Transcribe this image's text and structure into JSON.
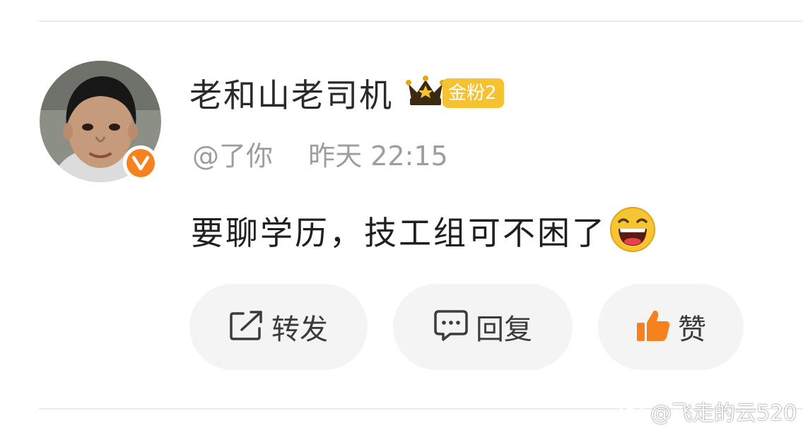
{
  "comment_card": {
    "username": "老和山老司机",
    "fan_badge": {
      "label": "金粉2",
      "icon": "crown-icon",
      "color": "#f5c332"
    },
    "verified_badge": {
      "icon": "verified-v-icon",
      "color": "#f5821f"
    },
    "reply_to": "@了你",
    "timestamp": "昨天 22:15",
    "comment_text": "要聊学历，技工组可不困了",
    "emoji": "laughing-face-emoji"
  },
  "actions": {
    "forward": {
      "label": "转发",
      "icon": "share-out-icon"
    },
    "reply": {
      "label": "回复",
      "icon": "comment-bubble-icon"
    },
    "like": {
      "label": "赞",
      "icon": "thumbs-up-icon",
      "color": "#f5821f"
    }
  },
  "watermark": {
    "text": "@飞走的云520",
    "icon": "weibo-logo"
  }
}
